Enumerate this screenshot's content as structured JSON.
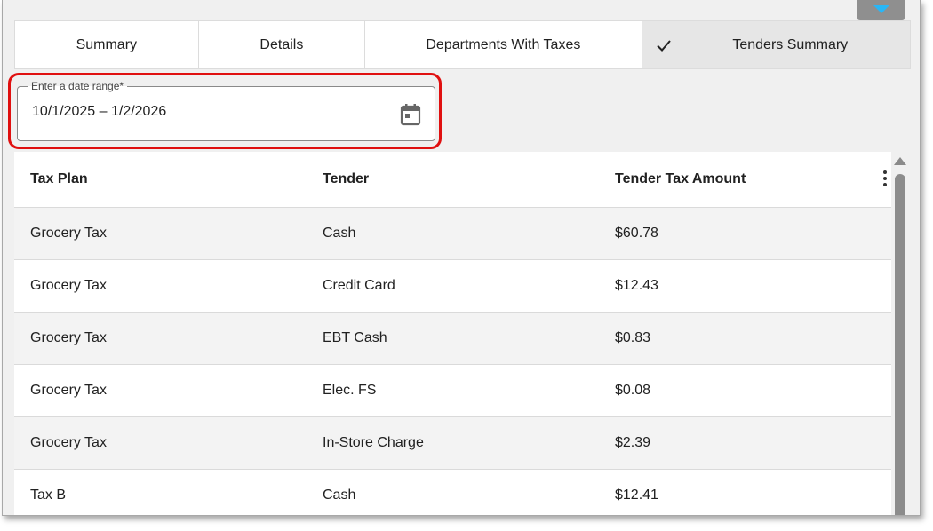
{
  "tabs": [
    {
      "label": "Summary",
      "active": false
    },
    {
      "label": "Details",
      "active": false
    },
    {
      "label": "Departments With Taxes",
      "active": false
    },
    {
      "label": "Tenders Summary",
      "active": true
    }
  ],
  "date_range": {
    "label": "Enter a date range*",
    "value": "10/1/2025 – 1/2/2026"
  },
  "grid": {
    "columns": [
      "Tax Plan",
      "Tender",
      "Tender Tax Amount"
    ],
    "rows": [
      [
        "Grocery Tax",
        "Cash",
        "$60.78"
      ],
      [
        "Grocery Tax",
        "Credit Card",
        "$12.43"
      ],
      [
        "Grocery Tax",
        "EBT Cash",
        "$0.83"
      ],
      [
        "Grocery Tax",
        "Elec. FS",
        "$0.08"
      ],
      [
        "Grocery Tax",
        "In-Store Charge",
        "$2.39"
      ],
      [
        "Tax B",
        "Cash",
        "$12.41"
      ]
    ]
  },
  "colors": {
    "highlight": "#e01010",
    "accent": "#29b6f6",
    "active_tab": "#e6e6e6"
  },
  "icons": {
    "calendar": "calendar-icon",
    "check": "check-icon",
    "menu": "kebab-menu-icon",
    "dropdown": "dropdown-arrow-icon"
  }
}
